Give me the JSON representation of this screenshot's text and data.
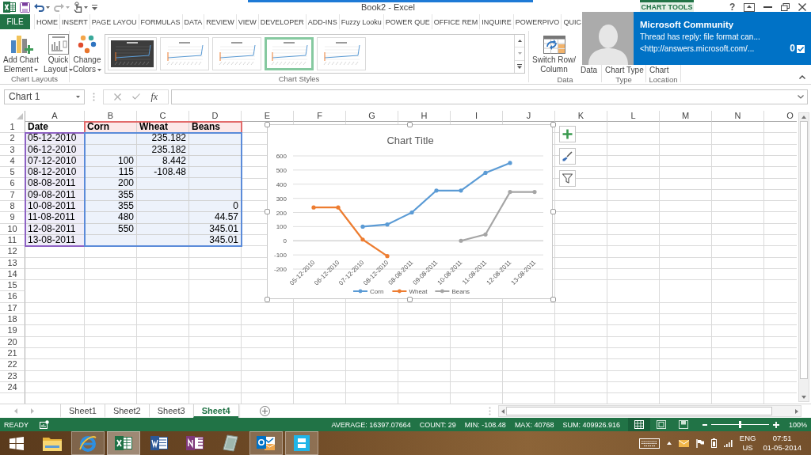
{
  "title_bar": {
    "title": "Book2 - Excel",
    "context_label": "CHART TOOLS",
    "help": "?"
  },
  "ribbon_tabs": [
    {
      "label": "FILE",
      "kind": "file",
      "selected": false
    },
    {
      "label": "HOME",
      "kind": "tab",
      "selected": false
    },
    {
      "label": "INSERT",
      "kind": "tab",
      "selected": false
    },
    {
      "label": "PAGE LAYOU",
      "kind": "tab",
      "selected": false
    },
    {
      "label": "FORMULAS",
      "kind": "tab",
      "selected": false
    },
    {
      "label": "DATA",
      "kind": "tab",
      "selected": false
    },
    {
      "label": "REVIEW",
      "kind": "tab",
      "selected": false
    },
    {
      "label": "VIEW",
      "kind": "tab",
      "selected": false
    },
    {
      "label": "DEVELOPER",
      "kind": "tab",
      "selected": false
    },
    {
      "label": "ADD-INS",
      "kind": "tab",
      "selected": false
    },
    {
      "label": "Fuzzy Looku",
      "kind": "tab",
      "selected": false
    },
    {
      "label": "POWER QUE",
      "kind": "tab",
      "selected": false
    },
    {
      "label": "OFFICE REM",
      "kind": "tab",
      "selected": false
    },
    {
      "label": "INQUIRE",
      "kind": "tab",
      "selected": false
    },
    {
      "label": "POWERPIVO",
      "kind": "tab",
      "selected": false
    },
    {
      "label": "QUIC",
      "kind": "tab",
      "selected": false
    }
  ],
  "ribbon_groups": [
    {
      "label": "Chart Layouts",
      "buttons": [
        {
          "kind": "add_element",
          "lines": [
            "Add Chart",
            "Element"
          ],
          "dropdown": true
        },
        {
          "kind": "quick_layout",
          "lines": [
            "Quick",
            "Layout"
          ],
          "dropdown": true
        }
      ]
    },
    {
      "label": "Chart Styles",
      "buttons": [
        {
          "kind": "change_colors",
          "lines": [
            "Change",
            "Colors"
          ],
          "dropdown": true
        }
      ],
      "gallery": [
        {
          "dark": true,
          "selected": false
        },
        {
          "dark": false,
          "selected": false
        },
        {
          "dark": false,
          "selected": false
        },
        {
          "dark": false,
          "selected": true
        },
        {
          "dark": false,
          "selected": false
        }
      ]
    },
    {
      "label": "Data",
      "buttons": [
        {
          "kind": "switch",
          "lines": [
            "Switch Row/",
            "Column"
          ],
          "dropdown": false
        },
        {
          "kind": "select_data",
          "lines": [
            "Data"
          ],
          "dropdown": false
        }
      ]
    },
    {
      "label": "Type",
      "buttons": [
        {
          "kind": "chart_type",
          "lines": [
            "Chart Type"
          ],
          "dropdown": false
        }
      ]
    },
    {
      "label": "Location",
      "buttons": [
        {
          "kind": "move_chart",
          "lines": [
            "Chart"
          ],
          "dropdown": false
        }
      ]
    }
  ],
  "formula_bar": {
    "name_box": "Chart 1",
    "function_button": "fx"
  },
  "sheet": {
    "columns": [
      "A",
      "B",
      "C",
      "D",
      "E",
      "F",
      "G",
      "H",
      "I",
      "J",
      "K",
      "L",
      "M",
      "N",
      "O"
    ],
    "rows": [
      {
        "number": "1",
        "kind": "header",
        "cells": [
          "Date",
          "Corn",
          "Wheat",
          "Beans"
        ]
      },
      {
        "number": "2",
        "kind": "data",
        "cells": [
          "05-12-2010",
          null,
          "235.182",
          null
        ]
      },
      {
        "number": "3",
        "kind": "data",
        "cells": [
          "06-12-2010",
          null,
          "235.182",
          null
        ]
      },
      {
        "number": "4",
        "kind": "data",
        "cells": [
          "07-12-2010",
          "100",
          "8.442",
          null
        ]
      },
      {
        "number": "5",
        "kind": "data",
        "cells": [
          "08-12-2010",
          "115",
          "-108.48",
          null
        ]
      },
      {
        "number": "6",
        "kind": "data",
        "cells": [
          "08-08-2011",
          "200",
          null,
          null
        ]
      },
      {
        "number": "7",
        "kind": "data",
        "cells": [
          "09-08-2011",
          "355",
          null,
          null
        ]
      },
      {
        "number": "8",
        "kind": "data",
        "cells": [
          "10-08-2011",
          "355",
          null,
          "0"
        ]
      },
      {
        "number": "9",
        "kind": "data",
        "cells": [
          "11-08-2011",
          "480",
          null,
          "44.57"
        ]
      },
      {
        "number": "10",
        "kind": "data",
        "cells": [
          "12-08-2011",
          "550",
          null,
          "345.01"
        ]
      },
      {
        "number": "11",
        "kind": "data",
        "cells": [
          "13-08-2011",
          null,
          null,
          "345.01"
        ]
      },
      {
        "number": "12"
      },
      {
        "number": "13"
      },
      {
        "number": "14"
      },
      {
        "number": "15"
      },
      {
        "number": "16"
      },
      {
        "number": "17"
      },
      {
        "number": "18"
      },
      {
        "number": "19"
      },
      {
        "number": "20"
      },
      {
        "number": "21"
      },
      {
        "number": "22"
      },
      {
        "number": "23"
      },
      {
        "number": "24"
      }
    ]
  },
  "chart": {
    "chart_data": {
      "type": "line",
      "title": "Chart Title",
      "categories": [
        "05-12-2010",
        "06-12-2010",
        "07-12-2010",
        "08-12-2010",
        "08-08-2011",
        "09-08-2011",
        "10-08-2011",
        "11-08-2011",
        "12-08-2011",
        "13-08-2011"
      ],
      "series": [
        {
          "name": "Corn",
          "color": "#5b9bd5",
          "values": [
            null,
            null,
            100,
            115,
            200,
            355,
            355,
            480,
            550,
            null
          ]
        },
        {
          "name": "Wheat",
          "color": "#ed7d31",
          "values": [
            235.182,
            235.182,
            8.442,
            -108.48,
            null,
            null,
            null,
            null,
            null,
            null
          ]
        },
        {
          "name": "Beans",
          "color": "#a5a5a5",
          "values": [
            null,
            null,
            null,
            null,
            null,
            null,
            0,
            44.57,
            345.01,
            345.01
          ]
        }
      ],
      "ylim": [
        -200,
        600
      ],
      "yticks": [
        -200,
        -100,
        0,
        100,
        200,
        300,
        400,
        500,
        600
      ],
      "grid": true,
      "legend": "bottom"
    }
  },
  "sheet_tabs": [
    {
      "label": "Sheet1",
      "selected": false
    },
    {
      "label": "Sheet2",
      "selected": false
    },
    {
      "label": "Sheet3",
      "selected": false
    },
    {
      "label": "Sheet4",
      "selected": true
    }
  ],
  "status_bar": {
    "mode": "READY",
    "stats": [
      "AVERAGE: 16397.07664",
      "COUNT: 29",
      "MIN: -108.48",
      "MAX: 40768",
      "SUM: 409926.916"
    ],
    "views": [
      {
        "kind": "normal",
        "selected": true
      },
      {
        "kind": "page_layout",
        "selected": false
      },
      {
        "kind": "page_break",
        "selected": false
      }
    ],
    "zoom": {
      "level": 0.5,
      "reading": "100%"
    }
  },
  "taskbar": {
    "apps": [
      {
        "kind": "start",
        "running": false,
        "selected": false
      },
      {
        "kind": "explorer",
        "running": false,
        "selected": false
      },
      {
        "kind": "browser",
        "running": true,
        "selected": false
      },
      {
        "kind": "spreadsheet",
        "running": true,
        "selected": true
      },
      {
        "kind": "document",
        "running": false,
        "selected": false
      },
      {
        "kind": "notebook",
        "running": false,
        "selected": false
      },
      {
        "kind": "card",
        "running": false,
        "selected": false
      },
      {
        "kind": "mail",
        "running": true,
        "selected": false
      },
      {
        "kind": "tile",
        "running": true,
        "selected": false
      }
    ],
    "tray": {
      "language": "ENG",
      "region": "US",
      "time": "07:51",
      "date": "01-05-2014"
    }
  },
  "notification": {
    "title": "Microsoft Community",
    "lines": [
      "Thread has reply: file format can...",
      "<http://answers.microsoft.com/..."
    ],
    "count": "0"
  }
}
